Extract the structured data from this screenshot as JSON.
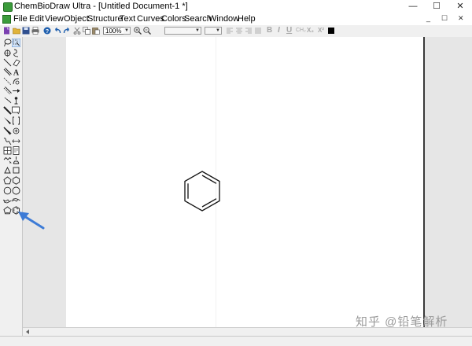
{
  "window": {
    "title": "ChemBioDraw Ultra - [Untitled Document-1 *]",
    "controls": [
      "—",
      "☐",
      "✕"
    ]
  },
  "menu": {
    "items": [
      "File",
      "Edit",
      "View",
      "Object",
      "Structure",
      "Text",
      "Curves",
      "Colors",
      "Search",
      "Window",
      "Help"
    ],
    "mdi_controls": [
      "_",
      "☐",
      "✕"
    ]
  },
  "toolbar": {
    "zoom": "100%",
    "format_buttons": [
      "B",
      "I",
      "U",
      "CH₂",
      "X₂",
      "X²"
    ],
    "color_swatch": "#000000"
  },
  "canvas": {
    "structure": "benzene"
  },
  "watermark": "知乎 @铅笔解析",
  "colors": {
    "arrow": "#3d7bd6",
    "app_icon": "#3b9b3b",
    "page_edge": "#3a3a3a"
  }
}
